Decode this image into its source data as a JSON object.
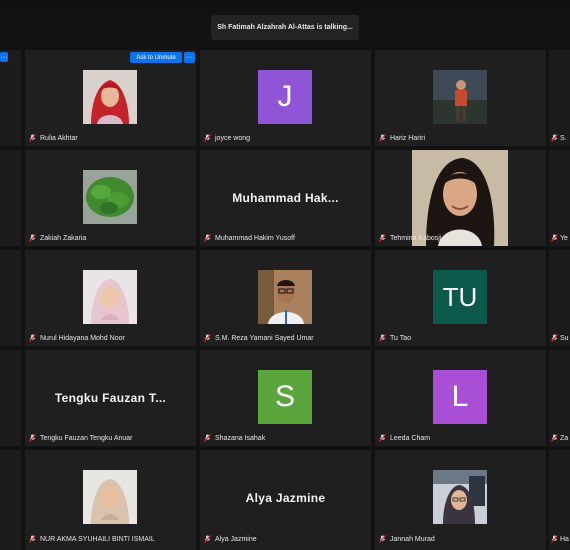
{
  "talking_indicator": "Sh Fatimah Alzahrah Al-Attas is talking...",
  "hover_controls": {
    "unmute_label": "Ask to Unmute",
    "more_label": "···"
  },
  "left_edge_more_label": "···",
  "colors": {
    "tile_bg": "#1f1f1f",
    "page_bg": "#121212",
    "mic_muted": "#e02828",
    "button_blue": "#0e72ed",
    "purple": "#8f55d6",
    "teal": "#0b5a4c",
    "green": "#5aa53c",
    "magenta": "#a94fd6"
  },
  "tiles": [
    {
      "name": "Rulia Akhtar",
      "type": "photo",
      "photo_icon": "woman-red-hijab-photo"
    },
    {
      "name": "joyce wong",
      "type": "letter",
      "letter": "J",
      "color": "#8f55d6"
    },
    {
      "name": "Hariz Hariri",
      "type": "photo",
      "photo_icon": "man-outdoor-photo"
    },
    {
      "name": "Zakiah Zakaria",
      "type": "photo",
      "photo_icon": "plant-photo"
    },
    {
      "name": "Muhammad Hakim Yusoff",
      "type": "text",
      "big": "Muhammad  Hak..."
    },
    {
      "name": "Tehmina Kabosji",
      "type": "photo",
      "photo_icon": "woman-portrait-photo"
    },
    {
      "name": "Nurul Hidayana Mohd Noor",
      "type": "photo",
      "photo_icon": "woman-pink-hijab-photo"
    },
    {
      "name": "S.M. Reza Yamani Sayed Umar",
      "type": "photo",
      "photo_icon": "man-glasses-photo"
    },
    {
      "name": "Tu Tao",
      "type": "letter",
      "letter": "TU",
      "color": "#0b5a4c"
    },
    {
      "name": "Tengku Fauzan Tengku Anuar",
      "type": "text",
      "big": "Tengku Fauzan  T..."
    },
    {
      "name": "Shazana Isahak",
      "type": "letter",
      "letter": "S",
      "color": "#5aa53c"
    },
    {
      "name": "Leeda Cham",
      "type": "letter",
      "letter": "L",
      "color": "#a94fd6"
    },
    {
      "name": "NUR AKMA SYUHAILI BINTI ISMAIL",
      "type": "photo",
      "photo_icon": "woman-beige-hijab-photo"
    },
    {
      "name": "Alya Jazmine",
      "type": "text",
      "big": "Alya Jazmine"
    },
    {
      "name": "Jannah Murad",
      "type": "photo",
      "photo_icon": "woman-room-photo"
    }
  ],
  "right_edge_names": [
    "S.",
    "Ye",
    "Su",
    "Za",
    "Ha"
  ]
}
